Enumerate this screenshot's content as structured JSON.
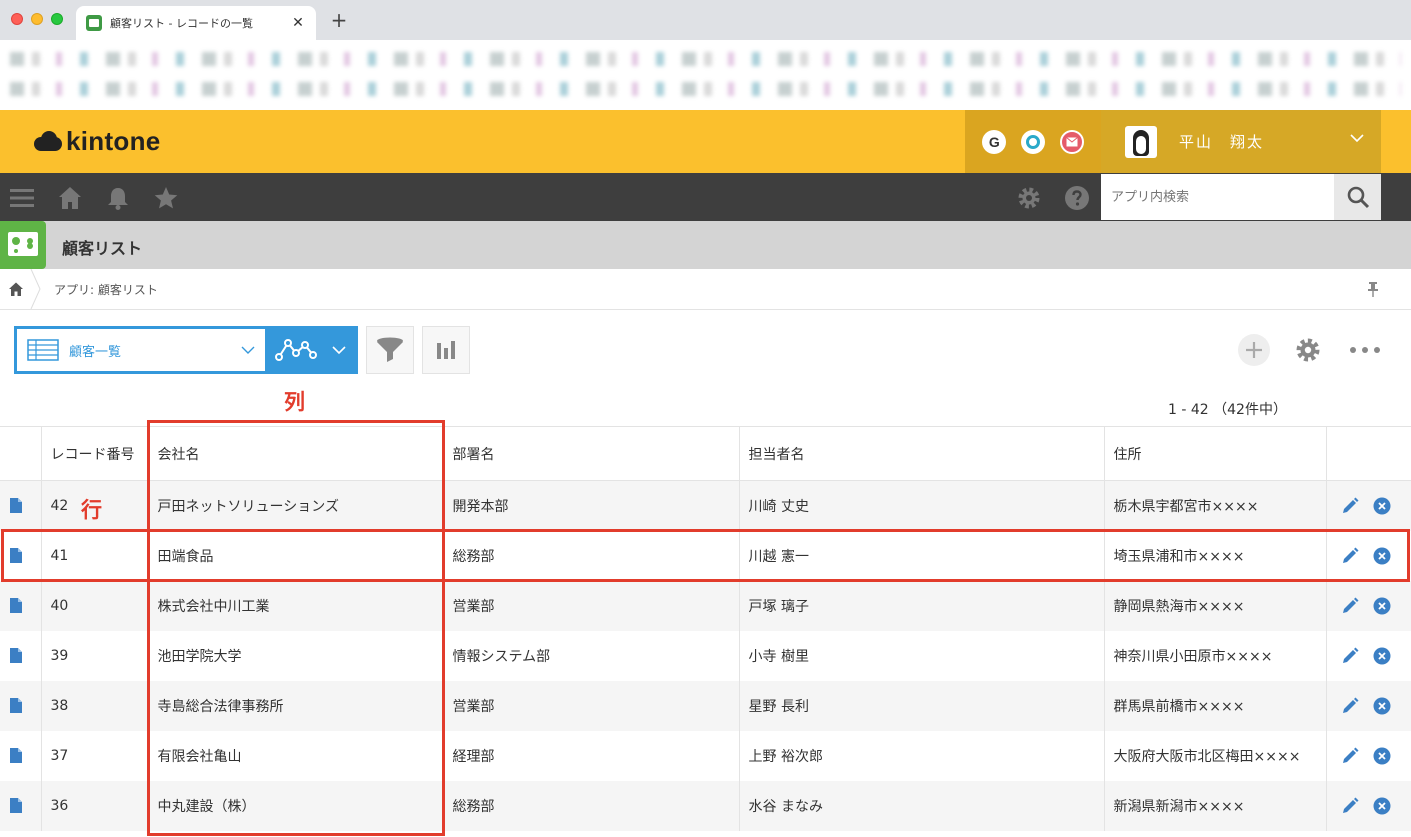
{
  "browser": {
    "tab_title": "顧客リスト - レコードの一覧",
    "tab_close": "✕",
    "new_tab": "+"
  },
  "header": {
    "logo_text": "kintone",
    "apps": [
      {
        "name": "g-app-icon",
        "letter": "G",
        "color": "#333333"
      },
      {
        "name": "o-app-icon",
        "letter": "",
        "color": "#2aa9c9"
      },
      {
        "name": "mail-app-icon",
        "letter": "",
        "color": "#e55b6a"
      }
    ],
    "user_name": "平山　翔太",
    "brand_color": "#fbc02d"
  },
  "toolbar": {
    "search_placeholder": "アプリ内検索"
  },
  "app": {
    "name": "顧客リスト"
  },
  "breadcrumb": {
    "text": "アプリ: 顧客リスト"
  },
  "view": {
    "selected": "顧客一覧",
    "accent_color": "#3498db"
  },
  "annotations": {
    "column_label": "列",
    "row_label": "行",
    "color": "#e23c2c"
  },
  "pager": {
    "text": "1 - 42 （42件中）"
  },
  "table": {
    "headers": [
      "レコード番号",
      "会社名",
      "部署名",
      "担当者名",
      "住所"
    ],
    "rows": [
      {
        "id": "42",
        "company": "戸田ネットソリューションズ",
        "dept": "開発本部",
        "person": "川崎 丈史",
        "address": "栃木県宇都宮市××××"
      },
      {
        "id": "41",
        "company": "田端食品",
        "dept": "総務部",
        "person": "川越 憲一",
        "address": "埼玉県浦和市××××"
      },
      {
        "id": "40",
        "company": "株式会社中川工業",
        "dept": "営業部",
        "person": "戸塚 璃子",
        "address": "静岡県熱海市××××"
      },
      {
        "id": "39",
        "company": "池田学院大学",
        "dept": "情報システム部",
        "person": "小寺 樹里",
        "address": "神奈川県小田原市××××"
      },
      {
        "id": "38",
        "company": "寺島総合法律事務所",
        "dept": "営業部",
        "person": "星野 長利",
        "address": "群馬県前橋市××××"
      },
      {
        "id": "37",
        "company": "有限会社亀山",
        "dept": "経理部",
        "person": "上野 裕次郎",
        "address": "大阪府大阪市北区梅田××××"
      },
      {
        "id": "36",
        "company": "中丸建設（株）",
        "dept": "総務部",
        "person": "水谷 まなみ",
        "address": "新潟県新潟市××××"
      }
    ]
  }
}
